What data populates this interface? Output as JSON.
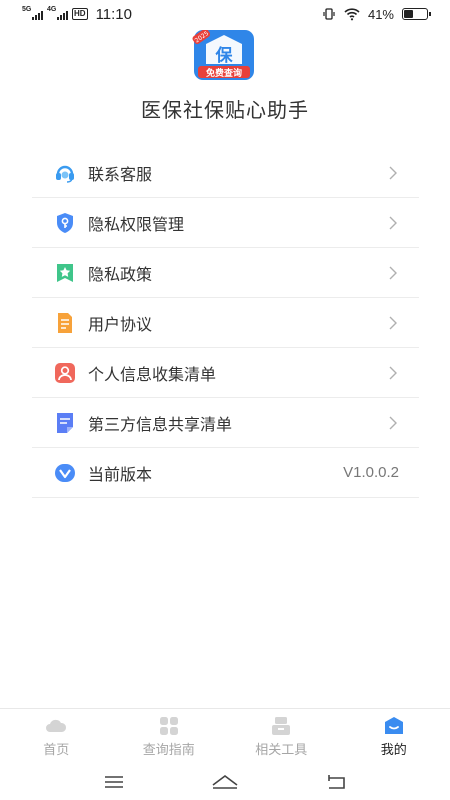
{
  "status": {
    "net1": "5G",
    "net2": "4G",
    "hd": "HD",
    "time": "11:10",
    "battery": "41%",
    "battery_level": 0.41
  },
  "app": {
    "name": "医保社保贴心助手",
    "logo_char": "保",
    "logo_badge": "免费查询",
    "logo_year": "2025"
  },
  "menu": {
    "items": [
      {
        "label": "联系客服",
        "icon": "headset-icon",
        "color": "#3a9bf0"
      },
      {
        "label": "隐私权限管理",
        "icon": "shield-key-icon",
        "color": "#4a8cf7"
      },
      {
        "label": "隐私政策",
        "icon": "bookmark-star-icon",
        "color": "#3fc58a"
      },
      {
        "label": "用户协议",
        "icon": "document-icon",
        "color": "#f7a23a"
      },
      {
        "label": "个人信息收集清单",
        "icon": "person-icon",
        "color": "#f0685c"
      },
      {
        "label": "第三方信息共享清单",
        "icon": "note-icon",
        "color": "#5b7ef5"
      },
      {
        "label": "当前版本",
        "icon": "version-icon",
        "color": "#4a8cf7"
      }
    ],
    "version_value": "V1.0.0.2"
  },
  "tabs": [
    {
      "label": "首页",
      "icon": "cloud-icon"
    },
    {
      "label": "查询指南",
      "icon": "grid-icon"
    },
    {
      "label": "相关工具",
      "icon": "tools-icon"
    },
    {
      "label": "我的",
      "icon": "profile-icon",
      "active": true
    }
  ],
  "colors": {
    "accent": "#3a8cf0",
    "text": "#333333",
    "inactive": "#a6a6a6"
  }
}
